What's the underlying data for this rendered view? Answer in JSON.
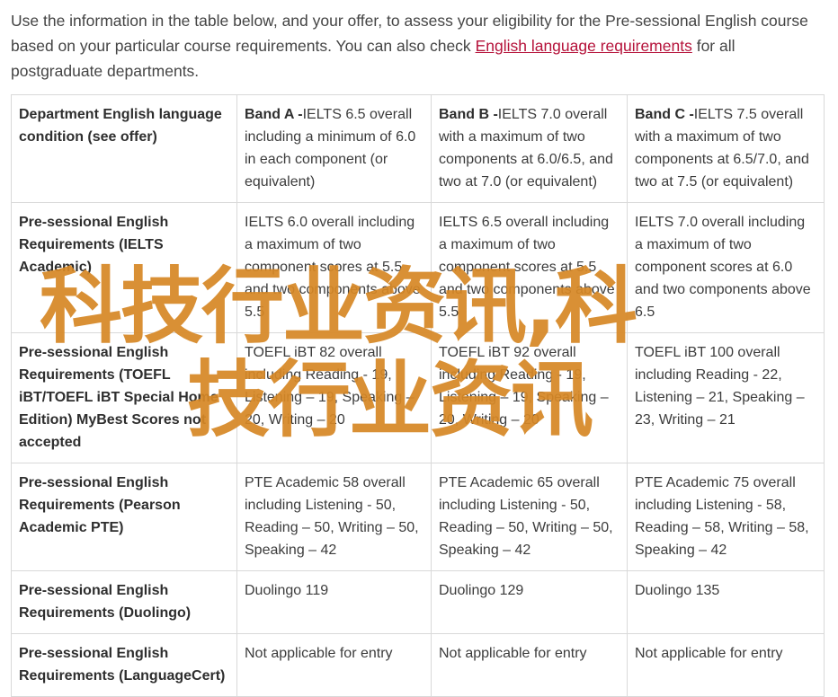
{
  "intro": {
    "text_before": "Use the information in the table below, and your offer, to assess your eligibility for the Pre-sessional English course based on your particular course requirements. You can also check ",
    "link": "English language requirements",
    "text_after": " for all postgraduate departments."
  },
  "table": {
    "header": {
      "label": "Department English language condition (see offer)",
      "bands": [
        {
          "name": "Band A -",
          "desc": "IELTS 6.5 overall including a minimum of 6.0 in each component (or equivalent)"
        },
        {
          "name": "Band B -",
          "desc": "IELTS 7.0 overall with a maximum of two components at 6.0/6.5, and two at 7.0 (or equivalent)"
        },
        {
          "name": "Band C -",
          "desc": "IELTS 7.5 overall with a maximum of two components at 6.5/7.0, and two at 7.5 (or equivalent)"
        }
      ]
    },
    "rows": [
      {
        "label": "Pre-sessional English Requirements (IELTS Academic)",
        "cells": [
          "IELTS 6.0 overall including a maximum of two component scores at 5.5 and two components above 5.5",
          "IELTS 6.5 overall including a maximum of two component scores at 5.5 and two components above 5.5",
          "IELTS 7.0 overall including a maximum of two component scores at 6.0 and two components above 6.5"
        ]
      },
      {
        "label": "Pre-sessional English Requirements (TOEFL iBT/TOEFL iBT Special Home Edition) MyBest Scores not accepted",
        "cells": [
          "TOEFL iBT 82 overall including Reading - 19, Listening – 19, Speaking – 20, Writing – 20",
          "TOEFL iBT 92 overall including Reading - 19, Listening – 19, Speaking – 20, Writing – 20",
          "TOEFL iBT 100 overall including Reading - 22, Listening – 21, Speaking – 23, Writing – 21"
        ]
      },
      {
        "label": "Pre-sessional English Requirements (Pearson Academic PTE)",
        "cells": [
          "PTE Academic 58 overall including Listening - 50, Reading – 50, Writing – 50, Speaking – 42",
          "PTE Academic 65 overall including Listening - 50, Reading – 50, Writing – 50, Speaking – 42",
          "PTE Academic 75 overall including Listening - 58, Reading – 58, Writing – 58, Speaking – 42"
        ]
      },
      {
        "label": "Pre-sessional English Requirements (Duolingo)",
        "cells": [
          "Duolingo 119",
          "Duolingo 129",
          "Duolingo 135"
        ]
      },
      {
        "label": "Pre-sessional English Requirements (LanguageCert)",
        "cells": [
          "Not applicable for entry",
          "Not applicable for entry",
          "Not applicable for entry"
        ]
      }
    ]
  },
  "watermark": {
    "line1": "科技行业资讯,科",
    "line2": "技行业资讯",
    "color": "#d68826"
  }
}
